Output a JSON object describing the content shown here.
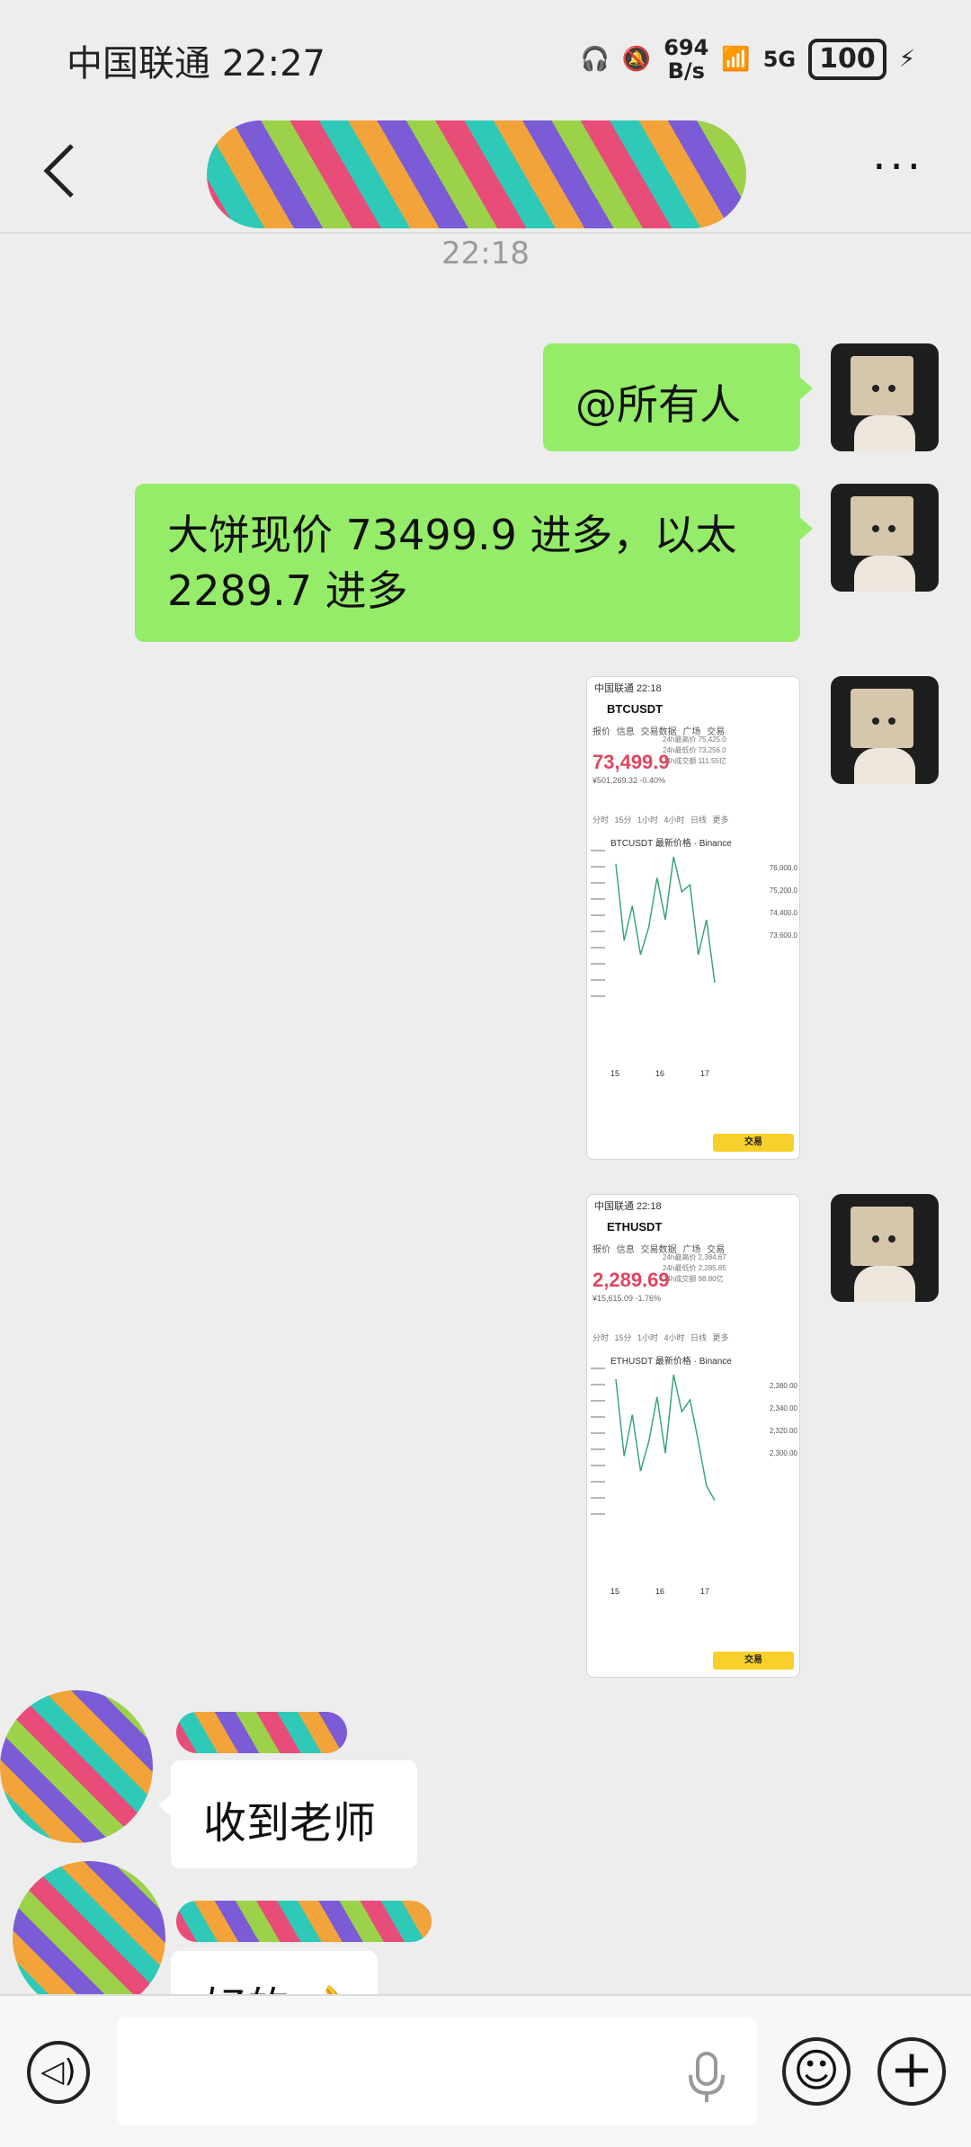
{
  "status": {
    "carrier_time": "中国联通 22:27",
    "speed_value": "694",
    "speed_unit": "B/s",
    "network": "5G",
    "battery": "100"
  },
  "chat": {
    "more_label": "···",
    "timestamp": "22:18",
    "messages": [
      {
        "sender": "me",
        "text": "@所有人"
      },
      {
        "sender": "me",
        "text": "大饼现价 73499.9 进多，以太 2289.7 进多"
      },
      {
        "sender": "me",
        "type": "image",
        "status": "中国联通 22:18",
        "pair": "BTCUSDT",
        "tabs": "报价 信息 交易数据 广场 交易",
        "price": "73,499.9",
        "sub": "¥501,269.32 -0.40%",
        "stats": [
          "24h最高价 75,425.0",
          "24h最低价 73,256.0",
          "24h成交额 111.55亿"
        ],
        "intervals": "分时 15分 1小时 4小时 日线 更多",
        "chart_title": "BTCUSDT 最新价格 · Binance",
        "axis": [
          "76,000.0",
          "75,200.0",
          "74,400.0",
          "73,600.0"
        ],
        "dates": [
          "15",
          "16",
          "17"
        ],
        "trade_label": "交易",
        "series": [
          75.2,
          74.1,
          74.6,
          73.9,
          74.3,
          75.0,
          74.4,
          75.3,
          74.8,
          74.9,
          73.9,
          74.4,
          73.5
        ]
      },
      {
        "sender": "me",
        "type": "image",
        "status": "中国联通 22:18",
        "pair": "ETHUSDT",
        "tabs": "报价 信息 交易数据 广场 交易",
        "price": "2,289.69",
        "sub": "¥15,615.09 -1.76%",
        "stats": [
          "24h最高价 2,384.67",
          "24h最低价 2,285.85",
          "24h成交额 98.80亿"
        ],
        "intervals": "分时 15分 1小时 4小时 日线 更多",
        "chart_title": "ETHUSDT 最新价格 · Binance",
        "axis": [
          "2,380.00",
          "2,340.00",
          "2,320.00",
          "2,300.00"
        ],
        "dates": [
          "15",
          "16",
          "17"
        ],
        "trade_label": "交易",
        "series": [
          2372,
          2320,
          2348,
          2310,
          2330,
          2360,
          2322,
          2375,
          2350,
          2358,
          2330,
          2300,
          2290
        ]
      },
      {
        "sender": "other",
        "text": "收到老师"
      },
      {
        "sender": "other",
        "text": "好的 👌"
      }
    ]
  },
  "input": {
    "voice_icon": "◁)",
    "emoji_icon": "☺",
    "plus_icon": "+",
    "placeholder": ""
  }
}
